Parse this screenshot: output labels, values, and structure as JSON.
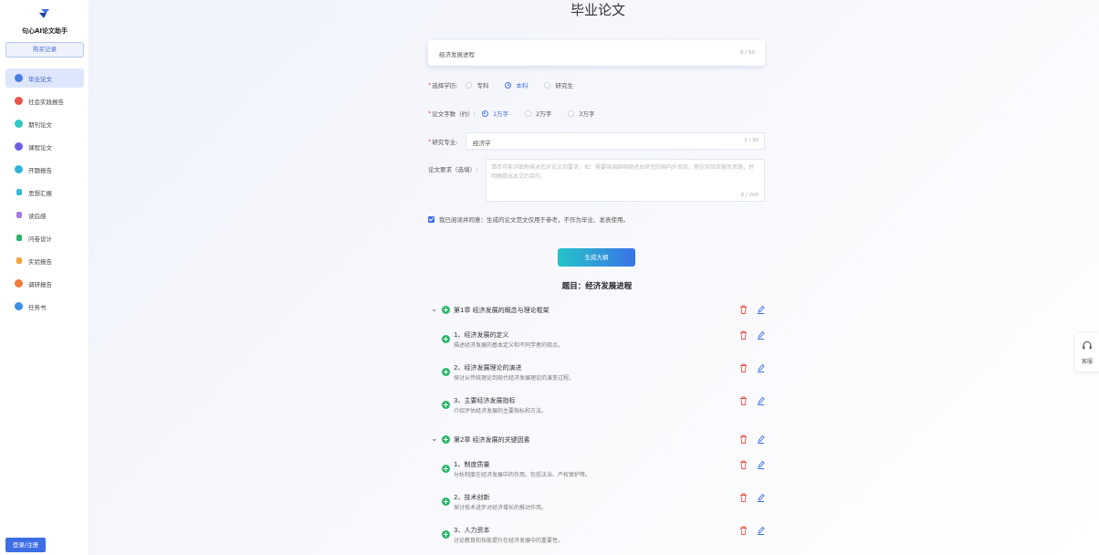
{
  "sidebar": {
    "brand": "句心AI论文助手",
    "buy_label": "购买记录",
    "login_label": "登录/注册",
    "items": [
      {
        "label": "毕业论文",
        "icon": "graduation-icon",
        "color": "#4a7ee6",
        "active": true
      },
      {
        "label": "社会实践报告",
        "icon": "society-icon",
        "color": "#e5534b"
      },
      {
        "label": "期刊论文",
        "icon": "journal-icon",
        "color": "#31c7c3"
      },
      {
        "label": "课程论文",
        "icon": "course-icon",
        "color": "#6e5ce6"
      },
      {
        "label": "开题报告",
        "icon": "proposal-icon",
        "color": "#2fb4d8"
      },
      {
        "label": "思想汇报",
        "icon": "thought-icon",
        "color": "#35b9d6"
      },
      {
        "label": "读后感",
        "icon": "reading-icon",
        "color": "#a77be0"
      },
      {
        "label": "问卷设计",
        "icon": "questionnaire-icon",
        "color": "#2cb36b"
      },
      {
        "label": "实验报告",
        "icon": "experiment-icon",
        "color": "#f0a23a"
      },
      {
        "label": "调研报告",
        "icon": "research-icon",
        "color": "#f07a3a"
      },
      {
        "label": "任务书",
        "icon": "task-icon",
        "color": "#3a8ee6"
      }
    ]
  },
  "main": {
    "title": "毕业论文",
    "topic": {
      "value": "经济发展进程",
      "count": "6 / 50"
    },
    "degree": {
      "label": "选择学历:",
      "options": [
        "专科",
        "本科",
        "研究生"
      ],
      "selected": "本科"
    },
    "words": {
      "label": "论文字数（约）:",
      "options": [
        "1万字",
        "2万字",
        "3万字"
      ],
      "selected": "1万字"
    },
    "major": {
      "label": "研究专业:",
      "value": "经济学",
      "count": "3 / 30"
    },
    "requirement": {
      "label": "论文要求（选填）:",
      "placeholder": "请尽可能详细地描述您对论文的要求，如：需要强调阐明阐述本研究的国内外现状，理论实验依据及思路，并明确提出本文的目的。",
      "count": "0 / 200"
    },
    "agree_text": "我已阅读并同意：生成的论文范文仅用于参考，不作为毕业、发表使用。",
    "generate_label": "生成大纲",
    "outline_title": "题目：经济发展进程"
  },
  "outline": [
    {
      "chapter": "第1章 经济发展的概念与理论框架",
      "sections": [
        {
          "title": "1、经济发展的定义",
          "desc": "描述经济发展的基本定义和不同学者的观点。"
        },
        {
          "title": "2、经济发展理论的演进",
          "desc": "探讨从传统理论到现代经济发展理论的演变过程。"
        },
        {
          "title": "3、主要经济发展指标",
          "desc": "介绍评估经济发展的主要指标和方法。"
        }
      ]
    },
    {
      "chapter": "第2章 经济发展的关键因素",
      "sections": [
        {
          "title": "1、制度质量",
          "desc": "分析制度在经济发展中的作用，包括法治、产权保护等。"
        },
        {
          "title": "2、技术创新",
          "desc": "探讨技术进步对经济增长的推动作用。"
        },
        {
          "title": "3、人力资本",
          "desc": "讨论教育和技能提升在经济发展中的重要性。"
        }
      ]
    }
  ],
  "service_label": "客服",
  "colors": {
    "primary": "#3d6ee6",
    "green": "#2cb36b",
    "delete": "#e5534b",
    "accent_teal": "#25c4c8"
  }
}
